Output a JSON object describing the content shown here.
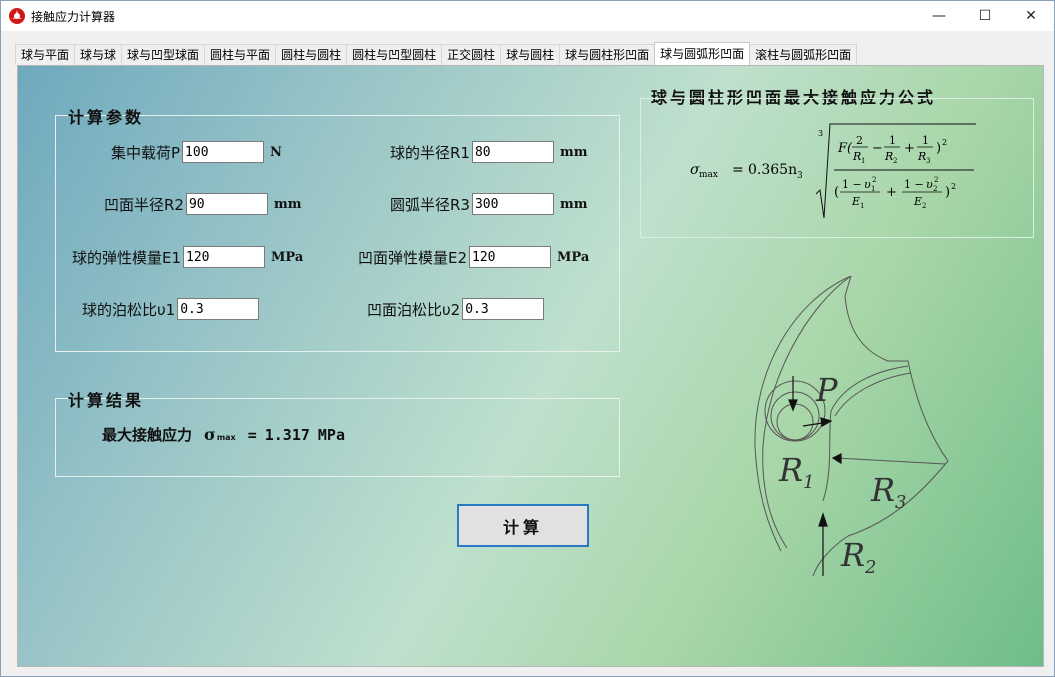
{
  "window": {
    "title": "接触应力计算器",
    "controls": {
      "minimize": "—",
      "maximize": "☐",
      "close": "✕"
    }
  },
  "tabs": [
    "球与平面",
    "球与球",
    "球与凹型球面",
    "圆柱与平面",
    "圆柱与圆柱",
    "圆柱与凹型圆柱",
    "正交圆柱",
    "球与圆柱",
    "球与圆柱形凹面",
    "球与圆弧形凹面",
    "滚柱与圆弧形凹面"
  ],
  "active_tab_index": 9,
  "params": {
    "group_title": "计算参数",
    "fields": {
      "P": {
        "label": "集中载荷P",
        "value": "100",
        "unit": "N"
      },
      "R1": {
        "label": "球的半径R1",
        "value": "80",
        "unit": "mm"
      },
      "R2": {
        "label": "凹面半径R2",
        "value": "90",
        "unit": "mm"
      },
      "R3": {
        "label": "圆弧半径R3",
        "value": "300",
        "unit": "mm"
      },
      "E1": {
        "label": "球的弹性模量E1",
        "value": "120",
        "unit": "MPa"
      },
      "E2": {
        "label": "凹面弹性模量E2",
        "value": "120",
        "unit": "MPa"
      },
      "v1": {
        "label": "球的泊松比υ1",
        "value": "0.3"
      },
      "v2": {
        "label": "凹面泊松比υ2",
        "value": "0.3"
      }
    }
  },
  "results": {
    "group_title": "计算结果",
    "label": "最大接触应力",
    "symbol": "σ",
    "symbol_sub": "max",
    "equals": "=",
    "value": "1.317",
    "unit": "MPa"
  },
  "calculate_button": "计算",
  "formula": {
    "title": "球与圆柱形凹面最大接触应力公式",
    "lhs": "σ",
    "lhs_sub": "max",
    "equals": "=",
    "coefficient": "0.365n",
    "coefficient_sub": "3",
    "root_index": "3"
  },
  "diagram": {
    "labels": {
      "P": "P",
      "R1": "R",
      "R1_sub": "1",
      "R3": "R",
      "R3_sub": "3",
      "R2": "R",
      "R2_sub": "2"
    }
  }
}
